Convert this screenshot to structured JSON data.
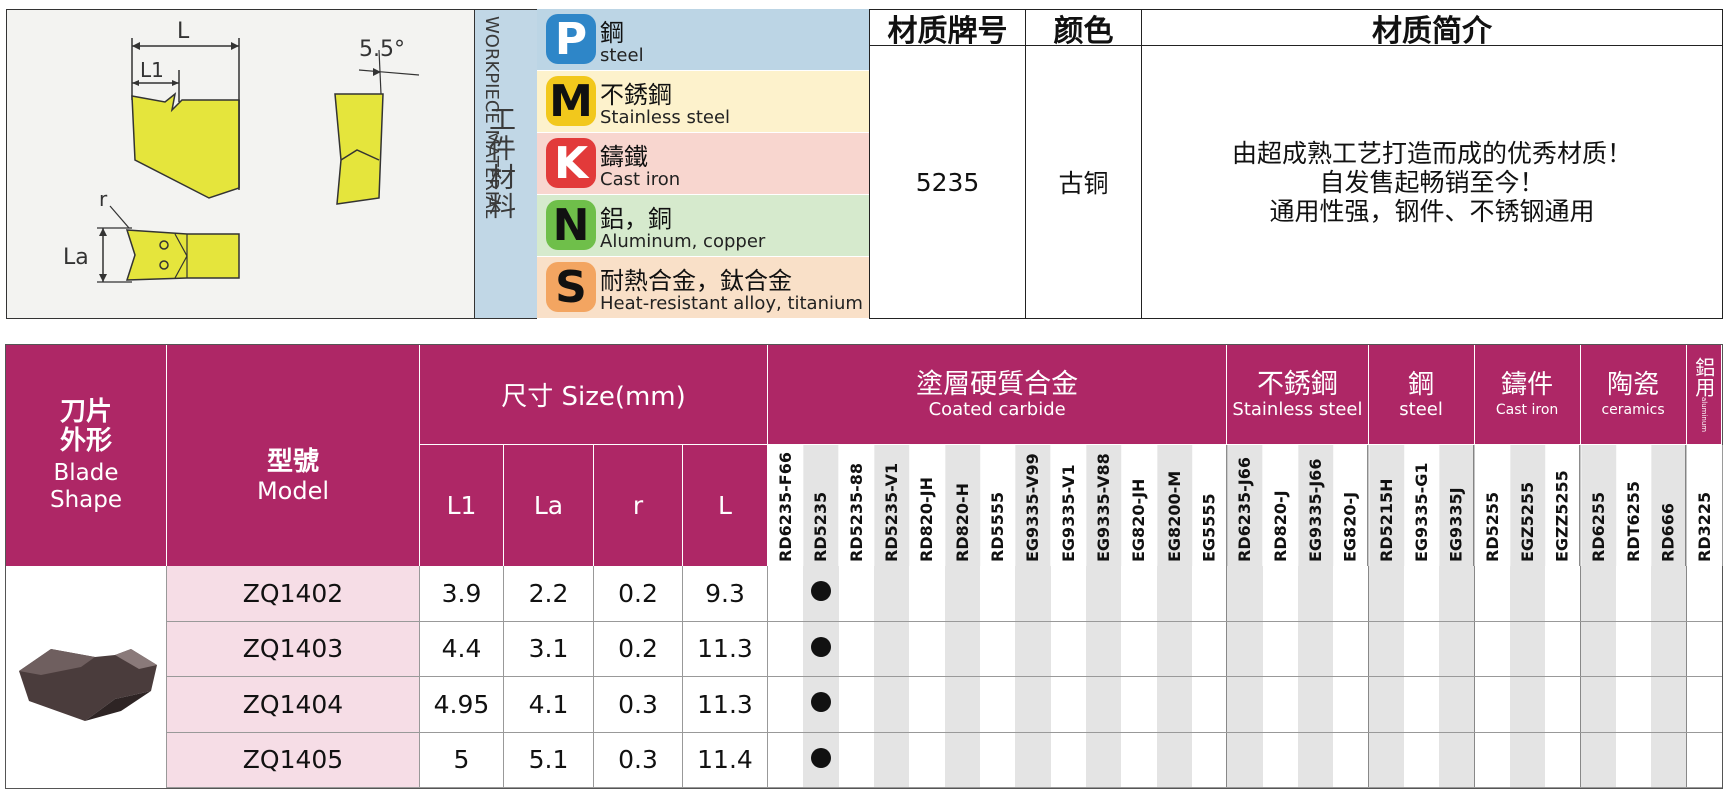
{
  "diagram": {
    "labels": {
      "L": "L",
      "L1": "L1",
      "angle": "5.5°",
      "r": "r",
      "La": "La"
    },
    "colors": {
      "blade": "#e5e53c",
      "line": "#333333"
    }
  },
  "workpiece": {
    "en": "WORKPIECE MATERIAL",
    "zh": "工件材料",
    "materials": [
      {
        "letter": "P",
        "zh": "鋼",
        "en": "steel",
        "badge_bg": "#2e86c8",
        "badge_fg": "#ffffff",
        "row_bg": "#bcd5e5"
      },
      {
        "letter": "M",
        "zh": "不銹鋼",
        "en": "Stainless steel",
        "badge_bg": "#f2c81c",
        "badge_fg": "#111111",
        "row_bg": "#fdf2cc"
      },
      {
        "letter": "K",
        "zh": "鑄鐵",
        "en": "Cast iron",
        "badge_bg": "#e23a3a",
        "badge_fg": "#ffffff",
        "row_bg": "#f8d6cf"
      },
      {
        "letter": "N",
        "zh": "鋁，銅",
        "en": "Aluminum, copper",
        "badge_bg": "#6fbf4a",
        "badge_fg": "#111111",
        "row_bg": "#d6eacd"
      },
      {
        "letter": "S",
        "zh": "耐熱合金，鈦合金",
        "en": "Heat-resistant alloy, titanium",
        "badge_bg": "#f3a561",
        "badge_fg": "#111111",
        "row_bg": "#f9e0c8"
      }
    ]
  },
  "material_info": {
    "headers": {
      "grade": "材质牌号",
      "color": "颜色",
      "intro": "材质简介"
    },
    "grade": "5235",
    "color": "古铜",
    "intro_lines": [
      "由超成熟工艺打造而成的优秀材质！",
      "自发售起畅销至今！",
      "通用性强，钢件、不锈钢通用"
    ]
  },
  "table": {
    "header_bg": "#ae2766",
    "blade_shape": {
      "zh1": "刀片",
      "zh2": "外形",
      "en1": "Blade",
      "en2": "Shape"
    },
    "model": {
      "zh": "型號",
      "en": "Model"
    },
    "size": {
      "title": "尺寸 Size(mm)",
      "cols": [
        "L1",
        "La",
        "r",
        "L"
      ]
    },
    "groups": [
      {
        "zh": "塗層硬質合金",
        "en": "Coated carbide",
        "codes": [
          "RD6235-F66",
          "RD5235",
          "RD5235-88",
          "RD5235-V1",
          "RD820-JH",
          "RD820-H",
          "RD5555",
          "EG9335-V99",
          "EG9335-V1",
          "EG9335-V88",
          "EG820-JH",
          "EG8200-M",
          "EG5555"
        ]
      },
      {
        "zh": "不銹鋼",
        "en": "Stainless steel",
        "codes": [
          "RD6235-J66",
          "RD820-J",
          "EG9335-J66",
          "EG820-J"
        ]
      },
      {
        "zh": "鋼",
        "en": "steel",
        "codes": [
          "RD5215H",
          "EG9335-G1",
          "EG9335J"
        ]
      },
      {
        "zh": "鑄件",
        "en": "Cast iron",
        "codes": [
          "RD5255",
          "EGZ5255",
          "EGZZ5255"
        ]
      },
      {
        "zh": "陶瓷",
        "en": "ceramics",
        "codes": [
          "RD6255",
          "RDT6255",
          "RD666"
        ]
      },
      {
        "zh": "鋁用",
        "en": "aluminum",
        "codes": [
          "RD3225"
        ]
      }
    ],
    "rows": [
      {
        "model": "ZQ1402",
        "L1": "3.9",
        "La": "2.2",
        "r": "0.2",
        "L": "9.3"
      },
      {
        "model": "ZQ1403",
        "L1": "4.4",
        "La": "3.1",
        "r": "0.2",
        "L": "11.3"
      },
      {
        "model": "ZQ1404",
        "L1": "4.95",
        "La": "4.1",
        "r": "0.3",
        "L": "11.3"
      },
      {
        "model": "ZQ1405",
        "L1": "5",
        "La": "5.1",
        "r": "0.3",
        "L": "11.4"
      }
    ],
    "mark_code": "RD5235"
  }
}
